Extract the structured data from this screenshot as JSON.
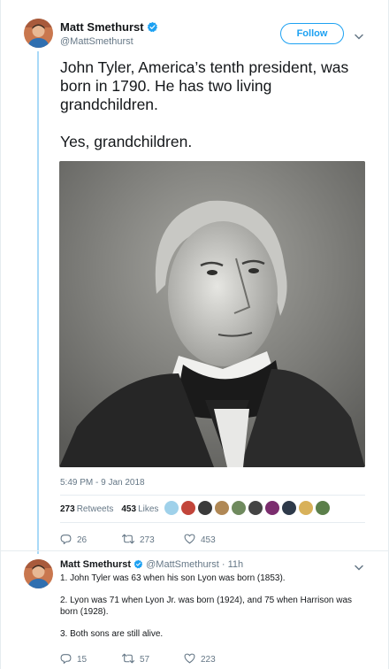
{
  "tweet": {
    "author": {
      "name": "Matt Smethurst",
      "handle": "@MattSmethurst",
      "verified": true
    },
    "follow_label": "Follow",
    "text_paragraphs": [
      "John Tyler, America’s tenth president, was born in 1790. He has two living grandchildren.",
      "Yes, grandchildren."
    ],
    "timestamp": "5:49 PM - 9 Jan 2018",
    "retweets": {
      "count": "273",
      "label": "Retweets"
    },
    "likes": {
      "count": "453",
      "label": "Likes"
    },
    "liker_avatar_colors": [
      "#9fd1ea",
      "#c2453a",
      "#3a3a3a",
      "#b08855",
      "#6f8a5e",
      "#444444",
      "#7b2d6e",
      "#2e3a4a",
      "#d8b15a",
      "#5b7f4a"
    ],
    "actions": {
      "replies": "26",
      "retweets": "273",
      "likes": "453"
    }
  },
  "reply": {
    "author": {
      "name": "Matt Smethurst",
      "handle": "@MattSmethurst",
      "verified": true,
      "time": "11h"
    },
    "text_paragraphs": [
      "1. John Tyler was 63 when his son Lyon was born (1853).",
      "2. Lyon was 71 when Lyon Jr. was born (1924), and 75 when Harrison was born (1928).",
      "3. Both sons are still alive."
    ],
    "actions": {
      "replies": "15",
      "retweets": "57",
      "likes": "223"
    }
  },
  "colors": {
    "accent": "#1da1f2",
    "thread_line": "#a9d9f7",
    "secondary_text": "#657786",
    "retweet_icon": "#657786"
  },
  "icons": [
    "verified-icon",
    "chevron-down-icon",
    "reply-icon",
    "retweet-icon",
    "heart-icon"
  ]
}
